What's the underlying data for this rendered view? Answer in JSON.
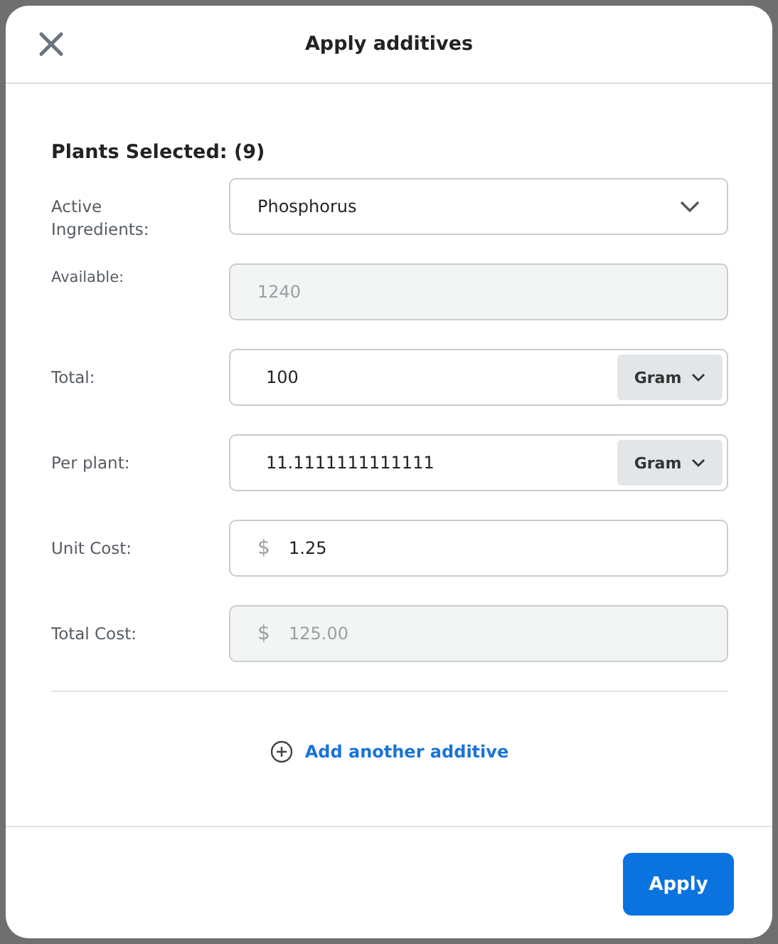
{
  "dialog": {
    "title": "Apply additives"
  },
  "heading": "Plants Selected: (9)",
  "fields": [
    {
      "label": "Active Ingredients:",
      "kind": "select",
      "value": "Phosphorus",
      "disabled": false
    },
    {
      "label": "Available:",
      "kind": "text",
      "value": "1240",
      "disabled": true
    },
    {
      "label": "Total:",
      "kind": "unit",
      "value": "100",
      "unit": "Gram",
      "disabled": false
    },
    {
      "label": "Per plant:",
      "kind": "unit",
      "value": "11.1111111111111",
      "unit": "Gram",
      "disabled": false
    },
    {
      "label": "Unit Cost:",
      "kind": "currency",
      "prefix": "$",
      "value": "1.25",
      "disabled": false
    },
    {
      "label": "Total Cost:",
      "kind": "currency",
      "prefix": "$",
      "value": "125.00",
      "disabled": true
    }
  ],
  "add_link": "Add another additive",
  "buttons": [
    "Apply"
  ]
}
